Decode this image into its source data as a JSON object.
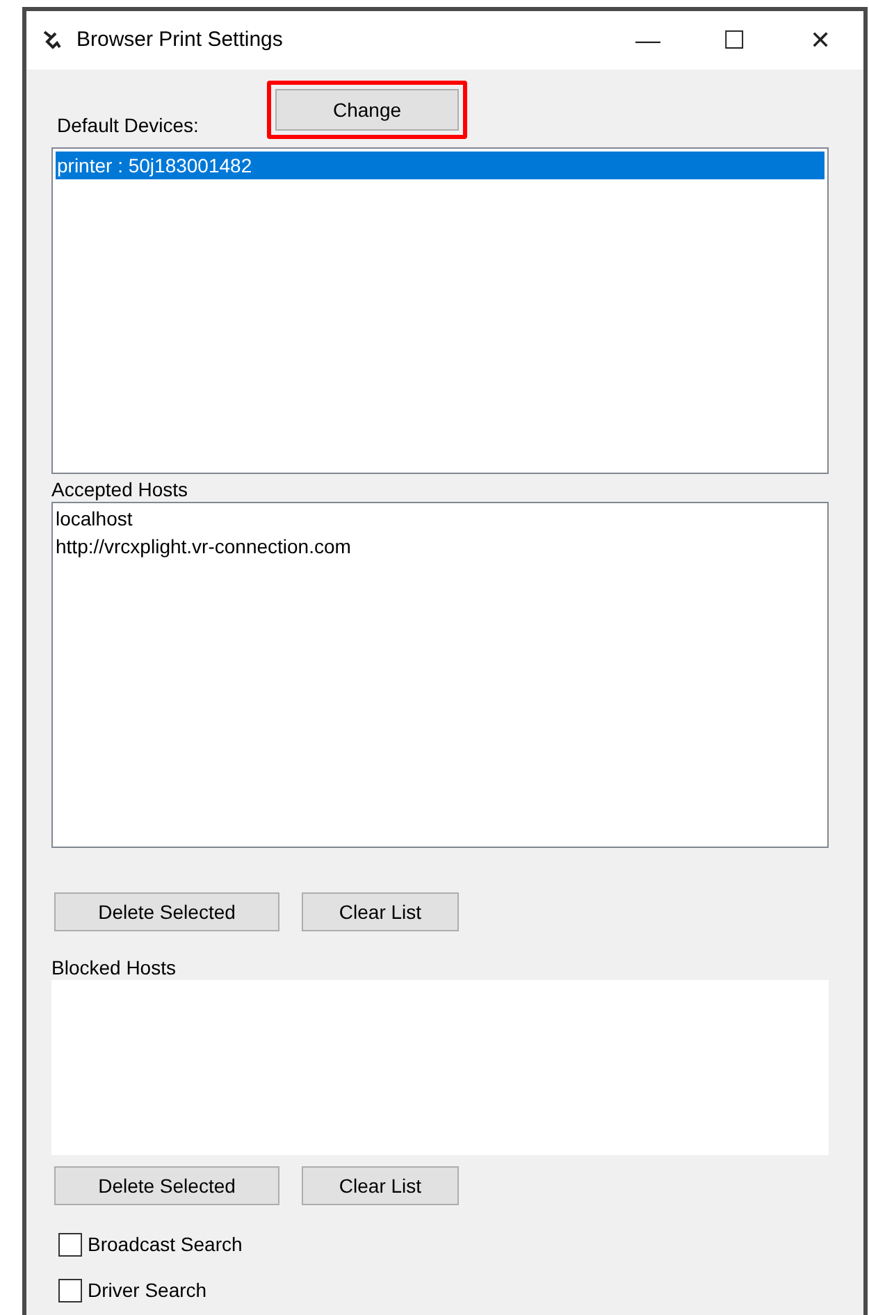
{
  "window": {
    "title": "Browser Print Settings",
    "controls": [
      "—",
      "☐",
      "✕"
    ]
  },
  "default_devices": {
    "label": "Default Devices:",
    "change_button": {
      "label": "Change",
      "highlighted": true
    },
    "items": [
      {
        "text": "printer : 50j183001482",
        "selected": true
      }
    ]
  },
  "accepted_hosts": {
    "label": "Accepted Hosts",
    "items": [
      {
        "text": "localhost",
        "selected": false
      },
      {
        "text": "http://vrcxplight.vr-connection.com",
        "selected": false
      }
    ],
    "buttons": [
      "Delete Selected",
      "Clear List"
    ]
  },
  "blocked_hosts": {
    "label": "Blocked Hosts",
    "buttons": [
      "Delete Selected",
      "Clear List"
    ]
  },
  "options": [
    {
      "label": "Broadcast Search",
      "checked": false
    },
    {
      "label": "Driver Search",
      "checked": false
    }
  ]
}
